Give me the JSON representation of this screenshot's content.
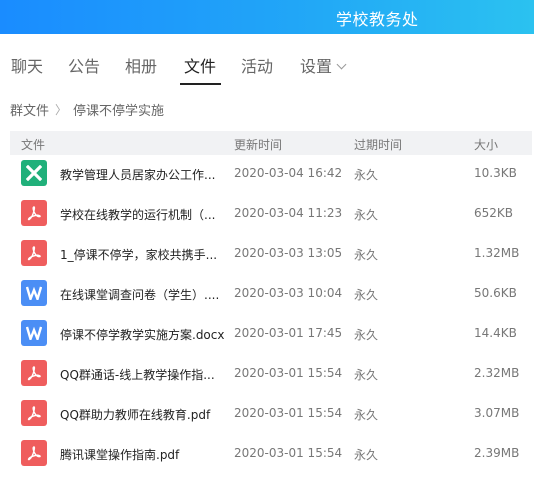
{
  "window": {
    "title": "学校教务处"
  },
  "tabs": [
    {
      "label": "聊天"
    },
    {
      "label": "公告"
    },
    {
      "label": "相册"
    },
    {
      "label": "文件"
    },
    {
      "label": "活动"
    },
    {
      "label": "设置"
    }
  ],
  "active_tab": "文件",
  "breadcrumb": {
    "root": "群文件",
    "separator": "〉",
    "current": "停课不停学实施"
  },
  "table": {
    "headers": {
      "file": "文件",
      "updated": "更新时间",
      "expires": "过期时间",
      "size": "大小"
    },
    "rows": [
      {
        "icon": "excel-icon",
        "color": "#20b07a",
        "name": "教学管理人员居家办公工作...",
        "updated": "2020-03-04 16:42",
        "expires": "永久",
        "size": "10.3KB"
      },
      {
        "icon": "pdf-icon",
        "color": "#ef5d5d",
        "name": "学校在线教学的运行机制（...",
        "updated": "2020-03-04 11:23",
        "expires": "永久",
        "size": "652KB"
      },
      {
        "icon": "pdf-icon",
        "color": "#ef5d5d",
        "name": "1_停课不停学，家校共携手...",
        "updated": "2020-03-03 13:05",
        "expires": "永久",
        "size": "1.32MB"
      },
      {
        "icon": "word-icon",
        "color": "#4b8ef5",
        "name": "在线课堂调查问卷（学生）....",
        "updated": "2020-03-03 10:04",
        "expires": "永久",
        "size": "50.6KB"
      },
      {
        "icon": "word-icon",
        "color": "#4b8ef5",
        "name": "停课不停学教学实施方案.docx",
        "updated": "2020-03-01 17:45",
        "expires": "永久",
        "size": "14.4KB"
      },
      {
        "icon": "pdf-icon",
        "color": "#ef5d5d",
        "name": "QQ群通话-线上教学操作指...",
        "updated": "2020-03-01 15:54",
        "expires": "永久",
        "size": "2.32MB"
      },
      {
        "icon": "pdf-icon",
        "color": "#ef5d5d",
        "name": "QQ群助力教师在线教育.pdf",
        "updated": "2020-03-01 15:54",
        "expires": "永久",
        "size": "3.07MB"
      },
      {
        "icon": "pdf-icon",
        "color": "#ef5d5d",
        "name": "腾讯课堂操作指南.pdf",
        "updated": "2020-03-01 15:54",
        "expires": "永久",
        "size": "2.39MB"
      }
    ]
  }
}
